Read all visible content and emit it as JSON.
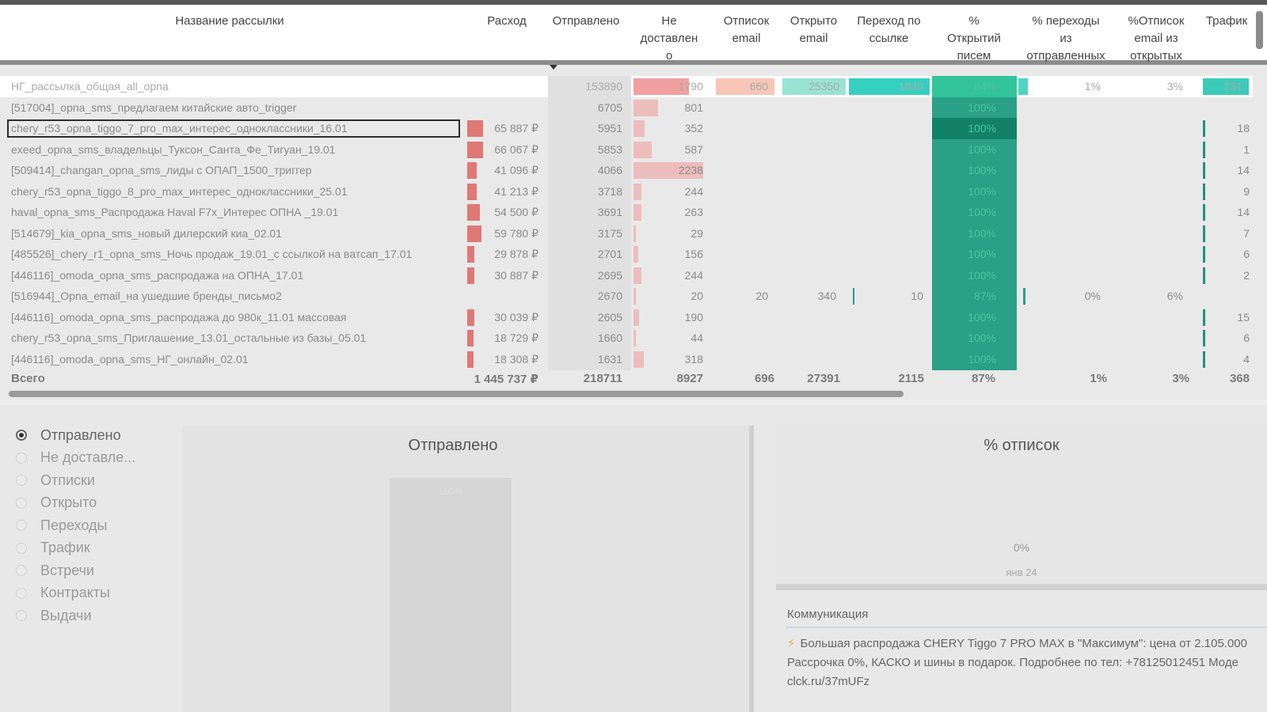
{
  "headers": {
    "name": "Название рассылки",
    "spend": "Расход",
    "sent": "Отправлено",
    "not_delivered": "Не\nдоставлен\nо",
    "unsub_email": "Отписок\nemail",
    "opened_email": "Открыто\nemail",
    "clicks": "Переход по\nссылке",
    "open_pct": "%\nОткрытий\nписем",
    "click_pct": "% переходы\nиз\nотправленных",
    "unsub_pct": "%Отписок\nemail из\nоткрытых",
    "traffic": "Трафик"
  },
  "rows": [
    {
      "name": "НГ_рассылка_общая_all_opna",
      "spend": "",
      "sent": "153890",
      "nd": "1790",
      "unsub": "660",
      "opened": "25350",
      "clicks": "1840",
      "open_pct": "84%",
      "click_pct": "1%",
      "unsub_pct": "3%",
      "traffic": "231"
    },
    {
      "name": "[517004]_opna_sms_предлагаем китайские авто_trigger",
      "spend": "",
      "sent": "6705",
      "nd": "801",
      "unsub": "",
      "opened": "",
      "clicks": "",
      "open_pct": "100%",
      "click_pct": "",
      "unsub_pct": "",
      "traffic": ""
    },
    {
      "name": "chery_r53_opna_tiggo_7_pro_max_интерес_одноклассники_16.01",
      "spend": "65 887 ₽",
      "sent": "5951",
      "nd": "352",
      "unsub": "",
      "opened": "",
      "clicks": "",
      "open_pct": "100%",
      "click_pct": "",
      "unsub_pct": "",
      "traffic": "18"
    },
    {
      "name": "exeed_opna_sms_владельцы_Туксон_Санта_Фе_Тигуан_19.01",
      "spend": "66 067 ₽",
      "sent": "5853",
      "nd": "587",
      "unsub": "",
      "opened": "",
      "clicks": "",
      "open_pct": "100%",
      "click_pct": "",
      "unsub_pct": "",
      "traffic": "1"
    },
    {
      "name": "[509414]_changan_opna_sms_лиды с ОПАП_1500_триггер",
      "spend": "41 096 ₽",
      "sent": "4066",
      "nd": "2238",
      "unsub": "",
      "opened": "",
      "clicks": "",
      "open_pct": "100%",
      "click_pct": "",
      "unsub_pct": "",
      "traffic": "14"
    },
    {
      "name": "chery_r53_opna_tiggo_8_pro_max_интерес_одноклассники_25.01",
      "spend": "41 213 ₽",
      "sent": "3718",
      "nd": "244",
      "unsub": "",
      "opened": "",
      "clicks": "",
      "open_pct": "100%",
      "click_pct": "",
      "unsub_pct": "",
      "traffic": "9"
    },
    {
      "name": "haval_opna_sms_Распродажа Haval F7x_Интерес ОПНА _19.01",
      "spend": "54 500 ₽",
      "sent": "3691",
      "nd": "263",
      "unsub": "",
      "opened": "",
      "clicks": "",
      "open_pct": "100%",
      "click_pct": "",
      "unsub_pct": "",
      "traffic": "14"
    },
    {
      "name": "[514679]_kia_opna_sms_новый дилерский киа_02.01",
      "spend": "59 780 ₽",
      "sent": "3175",
      "nd": "29",
      "unsub": "",
      "opened": "",
      "clicks": "",
      "open_pct": "100%",
      "click_pct": "",
      "unsub_pct": "",
      "traffic": "7"
    },
    {
      "name": "[485526]_chery_r1_opna_sms_Ночь продаж_19.01_с ссылкой на ватсап_17.01",
      "spend": "29 878 ₽",
      "sent": "2701",
      "nd": "156",
      "unsub": "",
      "opened": "",
      "clicks": "",
      "open_pct": "100%",
      "click_pct": "",
      "unsub_pct": "",
      "traffic": "6"
    },
    {
      "name": "[446116]_omoda_opna_sms_распродажа на ОПНА_17.01",
      "spend": "30 887 ₽",
      "sent": "2695",
      "nd": "244",
      "unsub": "",
      "opened": "",
      "clicks": "",
      "open_pct": "100%",
      "click_pct": "",
      "unsub_pct": "",
      "traffic": "2"
    },
    {
      "name": "[516944]_Opna_email_на ушедшие бренды_письмо2",
      "spend": "",
      "sent": "2670",
      "nd": "20",
      "unsub": "20",
      "opened": "340",
      "clicks": "10",
      "open_pct": "87%",
      "click_pct": "0%",
      "unsub_pct": "6%",
      "traffic": ""
    },
    {
      "name": "[446116]_omoda_opna_sms_распродажа до 980к_11.01 массовая",
      "spend": "30 039 ₽",
      "sent": "2605",
      "nd": "190",
      "unsub": "",
      "opened": "",
      "clicks": "",
      "open_pct": "100%",
      "click_pct": "",
      "unsub_pct": "",
      "traffic": "15"
    },
    {
      "name": "chery_r53_opna_sms_Приглашение_13.01_остальные из базы_05.01",
      "spend": "18 729 ₽",
      "sent": "1660",
      "nd": "44",
      "unsub": "",
      "opened": "",
      "clicks": "",
      "open_pct": "100%",
      "click_pct": "",
      "unsub_pct": "",
      "traffic": "6"
    },
    {
      "name": "[446116]_omoda_opna_sms_НГ_онлайн_02.01",
      "spend": "18 308 ₽",
      "sent": "1631",
      "nd": "318",
      "unsub": "",
      "opened": "",
      "clicks": "",
      "open_pct": "100%",
      "click_pct": "",
      "unsub_pct": "",
      "traffic": "4"
    }
  ],
  "totals": {
    "label": "Всего",
    "spend": "1 445 737 ₽",
    "sent": "218711",
    "nd": "8927",
    "unsub": "696",
    "opened": "27391",
    "clicks": "2115",
    "open_pct": "87%",
    "click_pct": "1%",
    "unsub_pct": "3%",
    "traffic": "368"
  },
  "metrics": [
    {
      "label": "Отправлено",
      "selected": true
    },
    {
      "label": "Не доставле...",
      "selected": false
    },
    {
      "label": "Отписки",
      "selected": false
    },
    {
      "label": "Открыто",
      "selected": false
    },
    {
      "label": "Переходы",
      "selected": false
    },
    {
      "label": "Трафик",
      "selected": false
    },
    {
      "label": "Встречи",
      "selected": false
    },
    {
      "label": "Контракты",
      "selected": false
    },
    {
      "label": "Выдачи",
      "selected": false
    }
  ],
  "chart_sent": {
    "title": "Отправлено",
    "bar_label": "100%"
  },
  "chart_unsub": {
    "title": "% отписок",
    "value": "0%",
    "x_label": "янв 24"
  },
  "communication": {
    "header": "Коммуникация",
    "line1": "Большая распродажа CHERY Tiggo 7 PRO MAX в \"Максимум\": цена от 2.105.000",
    "line2": "Рассрочка 0%, КАСКО и шины в подарок. Подробнее по тел: +78125012451 Моде",
    "line3": "clck.ru/37mUFz"
  },
  "colors": {
    "spend_bar": "#d9534f",
    "nd_bar": "#f0a0a0",
    "open_pct": "#2aa086",
    "traffic_bar": "#1f9378"
  }
}
